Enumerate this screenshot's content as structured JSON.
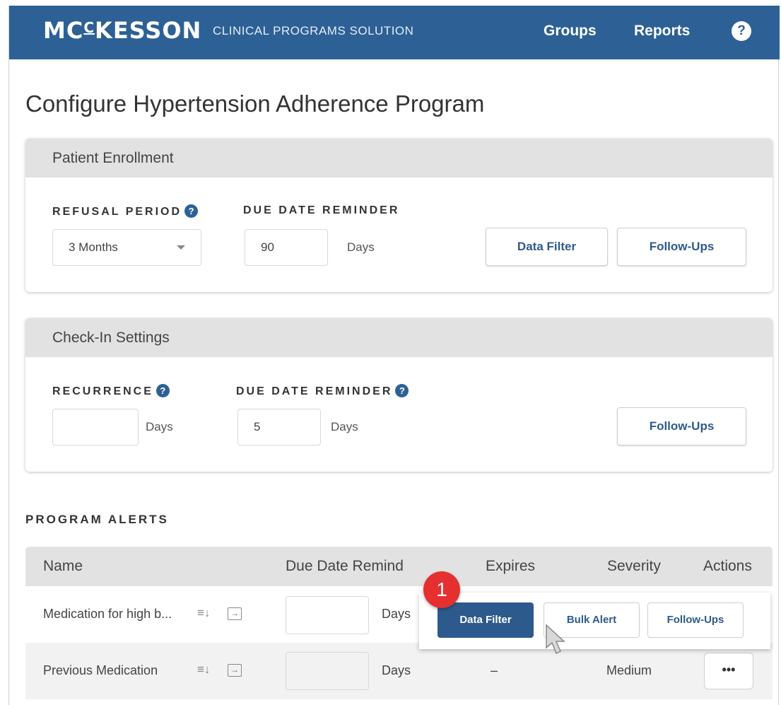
{
  "header": {
    "logo_main": "MC",
    "logo_sup": "C",
    "logo_rest": "KESSON",
    "product": "CLINICAL PROGRAMS SOLUTION",
    "nav": [
      "Groups",
      "Reports"
    ],
    "help_icon": "?"
  },
  "page": {
    "title": "Configure Hypertension Adherence Program"
  },
  "patient_enrollment": {
    "title": "Patient Enrollment",
    "refusal_label": "REFUSAL PERIOD",
    "refusal_value": "3 Months",
    "due_label": "DUE DATE REMINDER",
    "due_value": "90",
    "due_unit": "Days",
    "data_filter": "Data Filter",
    "follow_ups": "Follow-Ups"
  },
  "checkin": {
    "title": "Check-In Settings",
    "recurrence_label": "RECURRENCE",
    "recurrence_value": "",
    "recurrence_unit": "Days",
    "due_label": "DUE DATE REMINDER",
    "due_value": "5",
    "due_unit": "Days",
    "follow_ups": "Follow-Ups"
  },
  "alerts": {
    "title": "PROGRAM ALERTS",
    "columns": [
      "Name",
      "Due Date Remind",
      "Expires",
      "Severity",
      "Actions"
    ],
    "rows": [
      {
        "name": "Medication for high b...",
        "unit": "Days",
        "buttons": [
          "Data Filter",
          "Bulk Alert",
          "Follow-Ups"
        ]
      },
      {
        "name": "Previous Medication",
        "unit": "Days",
        "expires": "–",
        "severity": "Medium",
        "more": "•••"
      }
    ]
  },
  "annotation": {
    "step": "1"
  },
  "colors": {
    "brand": "#2d6195",
    "badge": "#e5302f"
  }
}
